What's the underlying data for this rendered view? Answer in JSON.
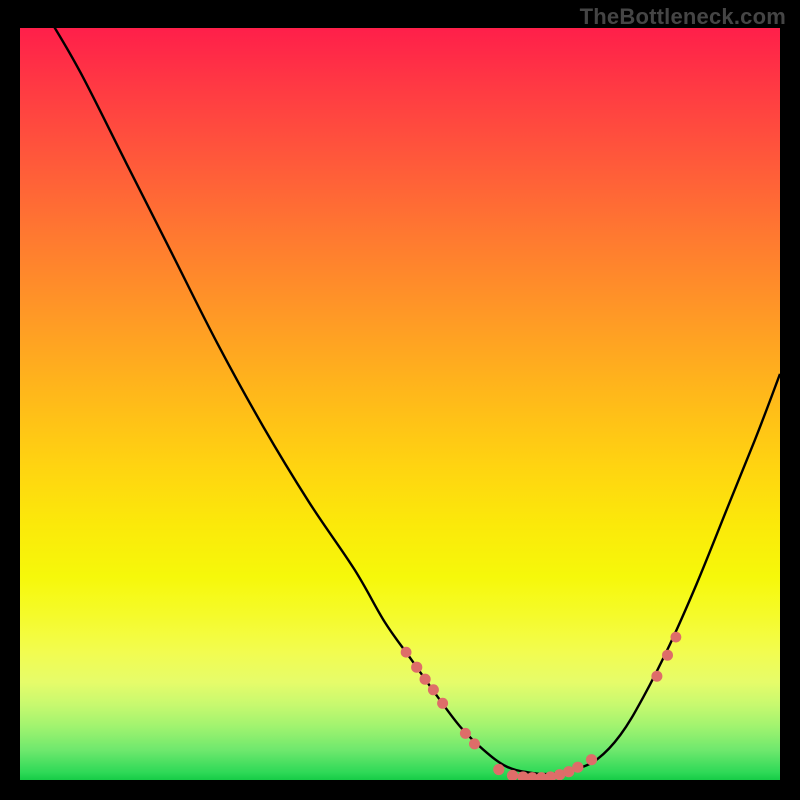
{
  "watermark": "TheBottleneck.com",
  "chart_data": {
    "type": "line",
    "title": "",
    "xlabel": "",
    "ylabel": "",
    "x_range": [
      0,
      100
    ],
    "y_range": [
      0,
      100
    ],
    "note": "x, y are pixel-space percentages inside the plot region (760x752). y=0 is TOP.",
    "series": [
      {
        "name": "curve",
        "points": [
          {
            "x": 4.0,
            "y": -1.0
          },
          {
            "x": 8.0,
            "y": 6.0
          },
          {
            "x": 14.0,
            "y": 18.0
          },
          {
            "x": 20.0,
            "y": 30.0
          },
          {
            "x": 26.0,
            "y": 42.0
          },
          {
            "x": 32.0,
            "y": 53.0
          },
          {
            "x": 38.0,
            "y": 63.0
          },
          {
            "x": 44.0,
            "y": 72.0
          },
          {
            "x": 48.0,
            "y": 79.0
          },
          {
            "x": 51.5,
            "y": 84.0
          },
          {
            "x": 55.0,
            "y": 89.0
          },
          {
            "x": 58.0,
            "y": 93.0
          },
          {
            "x": 61.0,
            "y": 96.0
          },
          {
            "x": 64.0,
            "y": 98.2
          },
          {
            "x": 67.0,
            "y": 99.0
          },
          {
            "x": 70.0,
            "y": 99.2
          },
          {
            "x": 73.0,
            "y": 98.6
          },
          {
            "x": 76.0,
            "y": 97.2
          },
          {
            "x": 79.0,
            "y": 94.0
          },
          {
            "x": 82.0,
            "y": 89.0
          },
          {
            "x": 85.5,
            "y": 82.0
          },
          {
            "x": 89.0,
            "y": 74.0
          },
          {
            "x": 93.0,
            "y": 64.0
          },
          {
            "x": 97.0,
            "y": 54.0
          },
          {
            "x": 100.0,
            "y": 46.0
          }
        ]
      }
    ],
    "scatter": {
      "name": "dots",
      "points": [
        {
          "x": 50.8,
          "y": 83.0,
          "r": 1.0
        },
        {
          "x": 52.2,
          "y": 85.0,
          "r": 1.2
        },
        {
          "x": 53.3,
          "y": 86.6,
          "r": 1.2
        },
        {
          "x": 54.4,
          "y": 88.0,
          "r": 1.1
        },
        {
          "x": 55.6,
          "y": 89.8,
          "r": 1.1
        },
        {
          "x": 58.6,
          "y": 93.8,
          "r": 1.1
        },
        {
          "x": 59.8,
          "y": 95.2,
          "r": 1.1
        },
        {
          "x": 63.0,
          "y": 98.6,
          "r": 1.2
        },
        {
          "x": 64.8,
          "y": 99.4,
          "r": 1.2
        },
        {
          "x": 66.2,
          "y": 99.6,
          "r": 1.2
        },
        {
          "x": 67.4,
          "y": 99.7,
          "r": 1.2
        },
        {
          "x": 68.6,
          "y": 99.7,
          "r": 1.2
        },
        {
          "x": 69.8,
          "y": 99.6,
          "r": 1.2
        },
        {
          "x": 71.0,
          "y": 99.3,
          "r": 1.2
        },
        {
          "x": 72.2,
          "y": 98.9,
          "r": 1.2
        },
        {
          "x": 73.4,
          "y": 98.3,
          "r": 1.2
        },
        {
          "x": 75.2,
          "y": 97.3,
          "r": 1.2
        },
        {
          "x": 83.8,
          "y": 86.2,
          "r": 1.1
        },
        {
          "x": 85.2,
          "y": 83.4,
          "r": 1.1
        },
        {
          "x": 86.3,
          "y": 81.0,
          "r": 1.0
        }
      ]
    }
  }
}
